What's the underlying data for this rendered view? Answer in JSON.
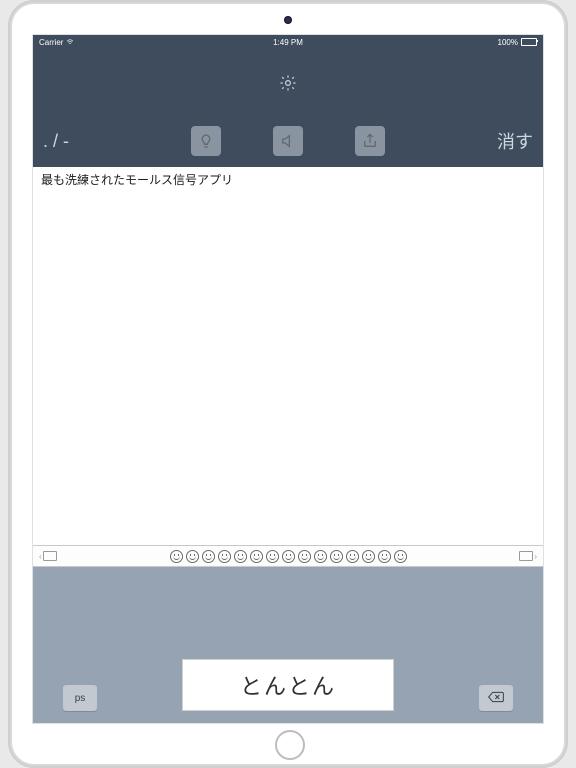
{
  "status_bar": {
    "carrier": "Carrier",
    "time": "1:49 PM",
    "battery_pct": "100%"
  },
  "header": {
    "morse_indicator": ". / -",
    "clear_label": "消す",
    "icons": {
      "settings": "gear-icon",
      "btn1": "lightbulb-icon",
      "btn2": "speaker-icon",
      "btn3": "share-icon"
    }
  },
  "text_area": {
    "content": "最も洗練されたモールス信号アプリ"
  },
  "emoji_strip": {
    "face_count": 15
  },
  "keyboard": {
    "tap_label": "とんとん",
    "ps_label": "ps",
    "delete_label": "⌫"
  }
}
